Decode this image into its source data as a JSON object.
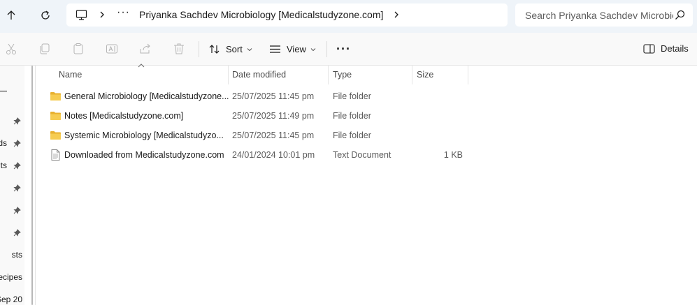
{
  "toolbar": {
    "back_label": "",
    "refresh_label": ""
  },
  "address": {
    "overflow": "···",
    "breadcrumb": "Priyanka Sachdev Microbiology [Medicalstudyzone.com]"
  },
  "search": {
    "placeholder": "Search Priyanka Sachdev Microbiology"
  },
  "commands": {
    "sort_label": "Sort",
    "view_label": "View",
    "more_label": "···",
    "details_label": "Details"
  },
  "columns": {
    "name": "Name",
    "date": "Date modified",
    "type": "Type",
    "size": "Size"
  },
  "files": [
    {
      "name": "General Microbiology [Medicalstudyzone...",
      "date": "25/07/2025 11:45 pm",
      "type": "File folder",
      "size": "",
      "icon": "folder-icon"
    },
    {
      "name": "Notes [Medicalstudyzone.com]",
      "date": "25/07/2025 11:49 pm",
      "type": "File folder",
      "size": "",
      "icon": "folder-icon"
    },
    {
      "name": "Systemic Microbiology [Medicalstudyzo...",
      "date": "25/07/2025 11:45 pm",
      "type": "File folder",
      "size": "",
      "icon": "folder-icon"
    },
    {
      "name": "Downloaded from Medicalstudyzone.com",
      "date": "24/01/2024 10:01 pm",
      "type": "Text Document",
      "size": "1 KB",
      "icon": "text-document-icon"
    }
  ],
  "nav": {
    "items": [
      {
        "label": "",
        "pinned": true
      },
      {
        "label": "ds",
        "pinned": true
      },
      {
        "label": "ts",
        "pinned": true
      },
      {
        "label": "",
        "pinned": true
      },
      {
        "label": "",
        "pinned": true
      },
      {
        "label": "",
        "pinned": true
      },
      {
        "label": "sts",
        "pinned": false
      },
      {
        "label": "ecipes",
        "pinned": false
      },
      {
        "label": "Sep 20",
        "pinned": false
      }
    ]
  },
  "colors": {
    "folder": "#f4c94c",
    "accent": "#0067c0"
  }
}
